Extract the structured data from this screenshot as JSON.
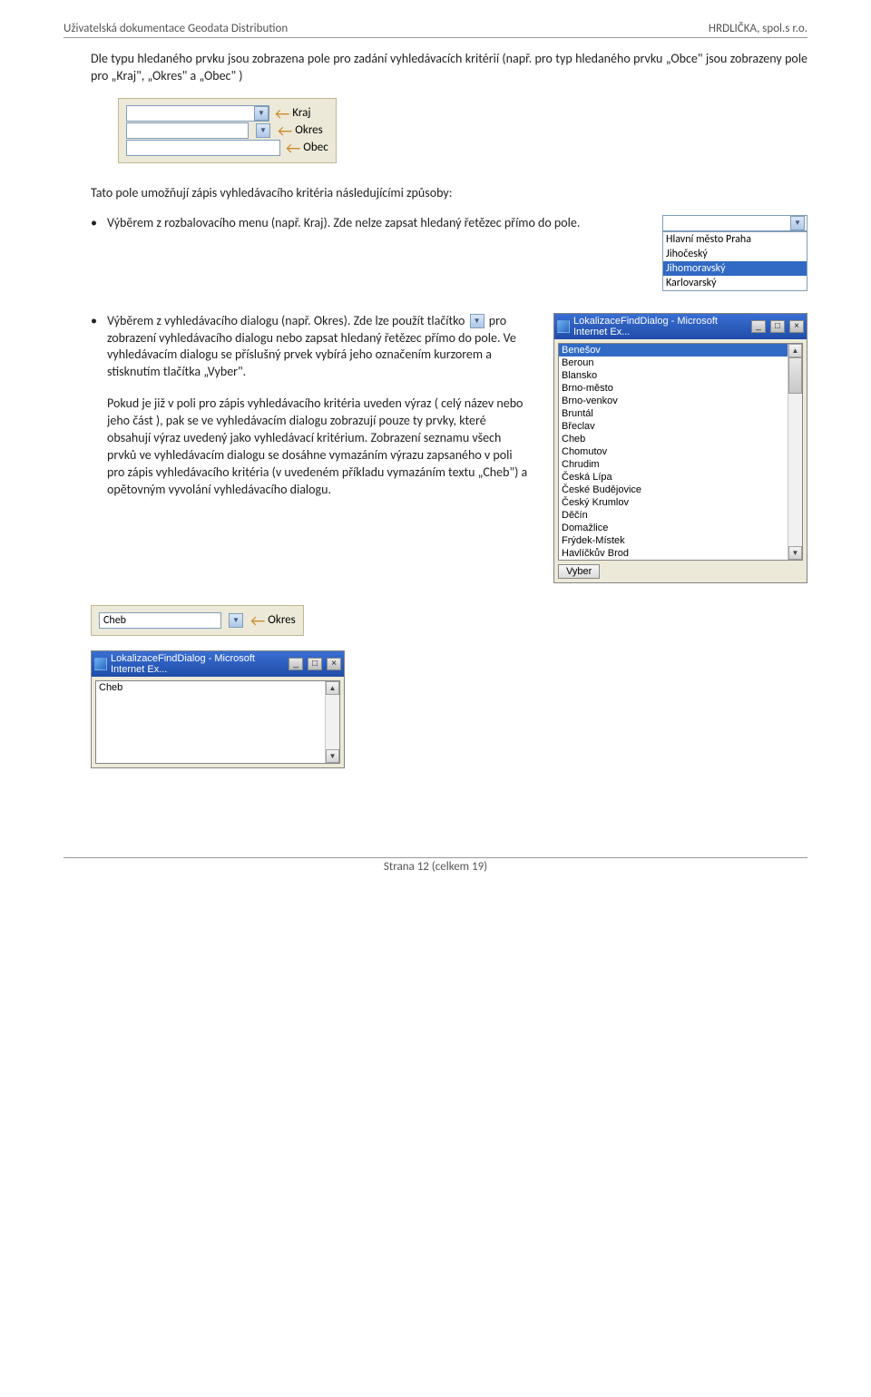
{
  "header": {
    "left": "Uživatelská dokumentace Geodata Distribution",
    "right": "HRDLIČKA, spol.s r.o."
  },
  "para1": "Dle typu hledaného prvku jsou zobrazena pole pro zadání vyhledávacích kritérií (např. pro typ hledaného prvku „Obce\" jsou zobrazeny pole pro „Kraj\", „Okres\" a „Obec\" )",
  "fields": {
    "kraj": "Kraj",
    "okres": "Okres",
    "obec": "Obec"
  },
  "para2": "Tato pole umožňují zápis vyhledávacího kritéria následujícími způsoby:",
  "bullet1": "Výběrem z rozbalovacího menu (např. Kraj). Zde nelze zapsat hledaný řetězec přímo do pole.",
  "kraj_list": [
    "Hlavní město Praha",
    "Jihočeský",
    "Jihomoravský",
    "Karlovarský"
  ],
  "kraj_sel_index": 2,
  "bullet2_a": "Výběrem z vyhledávacího dialogu     (např. Okres). Zde lze použít tlačítko ",
  "bullet2_b": " pro zobrazení vyhledávacího dialogu nebo zapsat hledaný řetězec přímo do pole. Ve vyhledávacím dialogu se příslušný prvek vybírá jeho označením kurzorem a stisknutím tlačítka „Vyber\".",
  "bullet2_c": "Pokud je již v poli pro zápis vyhledávacího kritéria uveden výraz ( celý název nebo jeho část ), pak se ve vyhledávacím dialogu zobrazují pouze ty prvky, které obsahují výraz uvedený jako vyhledávací kritérium. Zobrazení seznamu všech prvků ve vyhledávacím dialogu se dosáhne vymazáním výrazu zapsaného v poli pro zápis vyhledávacího kritéria (v uvedeném příkladu vymazáním textu „Cheb\") a opětovným vyvolání vyhledávacího dialogu.",
  "dialog": {
    "title": "LokalizaceFindDialog - Microsoft Internet Ex...",
    "items": [
      "Benešov",
      "Beroun",
      "Blansko",
      "Brno-město",
      "Brno-venkov",
      "Bruntál",
      "Břeclav",
      "Cheb",
      "Chomutov",
      "Chrudim",
      "Česká Lípa",
      "České Budějovice",
      "Český Krumlov",
      "Děčín",
      "Domažlice",
      "Frýdek-Místek",
      "Havlíčkův Brod"
    ],
    "sel_index": 0,
    "button": "Vyber"
  },
  "cheb": {
    "value": "Cheb",
    "label": "Okres"
  },
  "dialog2": {
    "title": "LokalizaceFindDialog - Microsoft Internet Ex...",
    "items": [
      "Cheb"
    ]
  },
  "footer": "Strana 12 (celkem 19)"
}
